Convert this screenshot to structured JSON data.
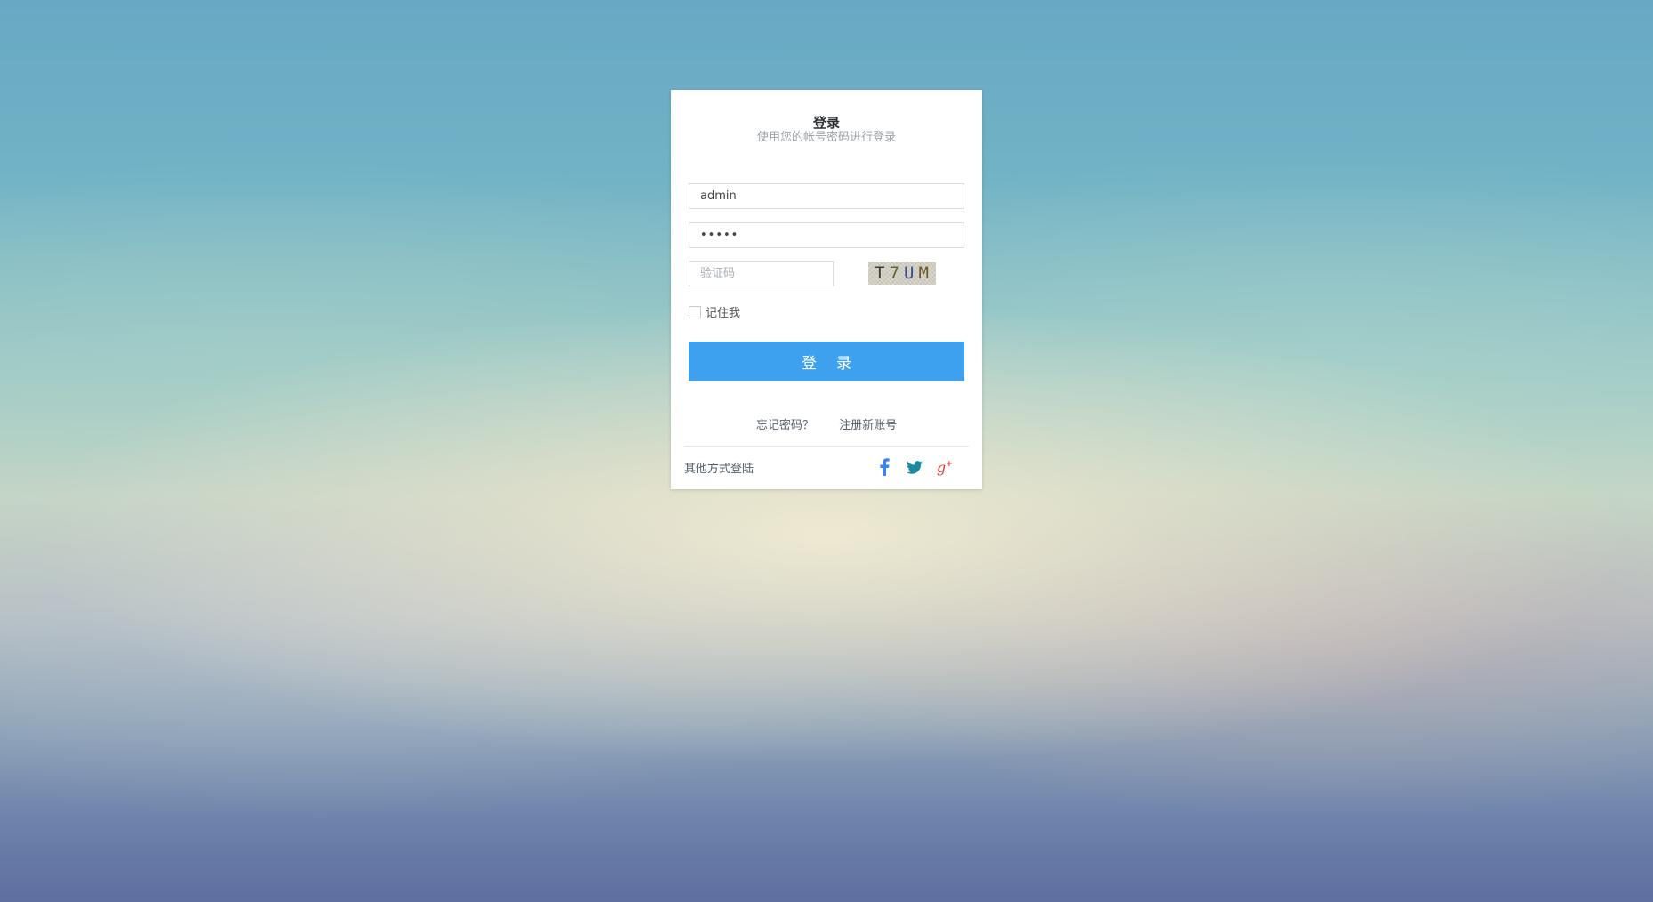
{
  "login": {
    "title": "登录",
    "subtitle": "使用您的帐号密码进行登录",
    "username": {
      "value": "admin"
    },
    "password": {
      "value": "•••••"
    },
    "captcha": {
      "placeholder": "验证码",
      "image_chars": [
        "T",
        "7",
        "U",
        "M"
      ]
    },
    "remember_label": "记住我",
    "submit_label": "登录",
    "forgot_label": "忘记密码？",
    "register_label": "注册新账号",
    "other_login_label": "其他方式登陆",
    "social": [
      {
        "icon": "facebook-icon",
        "color": "#3b82f6"
      },
      {
        "icon": "twitter-icon",
        "color": "#1a8aa0"
      },
      {
        "icon": "google-plus-icon",
        "color": "#e53935"
      }
    ]
  },
  "colors": {
    "primary_button": "#3da1f0",
    "card_background": "#ffffff"
  }
}
